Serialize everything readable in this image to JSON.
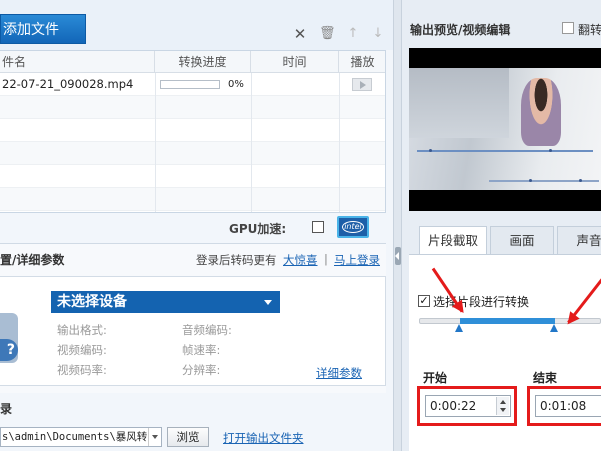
{
  "toolbar": {
    "add_file_label": "添加文件",
    "icons": [
      "close-icon",
      "trash-icon",
      "arrow-up-icon",
      "arrow-down-icon"
    ]
  },
  "file_table": {
    "columns": [
      "件名",
      "转换进度",
      "时间",
      "播放"
    ],
    "rows": [
      {
        "name": "22-07-21_090028.mp4",
        "progress_percent": 0,
        "progress_text": "0%",
        "time": ""
      }
    ]
  },
  "gpu": {
    "label": "GPU加速:",
    "checked": false,
    "intel_label": "intel"
  },
  "params": {
    "title": "置/详细参数",
    "login_tip": "登录后转码更有",
    "login_link": "大惊喜",
    "separator": "|",
    "login_now": "马上登录",
    "device_select": "未选择设备",
    "labels": {
      "output_format": "输出格式:",
      "video_codec": "视频编码:",
      "video_bitrate": "视频码率:",
      "audio_codec": "音频编码:",
      "frame_rate": "帧速率:",
      "resolution": "分辨率:"
    },
    "detail_link": "详细参数"
  },
  "output": {
    "title": "录",
    "path": "s\\admin\\Documents\\暴风转",
    "browse_label": "浏览",
    "open_folder_label": "打开输出文件夹"
  },
  "preview": {
    "title": "输出预览/视频编辑",
    "flip_label": "翻转",
    "flip_checked": false
  },
  "tabs": [
    "片段截取",
    "画面",
    "声音"
  ],
  "clip": {
    "enable_label": "选择片段进行转换",
    "enabled": true,
    "range_start_fraction": 0.22,
    "range_end_fraction": 0.74,
    "start_label": "开始",
    "start_time": "0:00:22",
    "end_label": "结束",
    "end_time": "0:01:08"
  },
  "colors": {
    "accent": "#1463b0",
    "highlight": "#e41b1b",
    "link": "#1a64b4"
  }
}
